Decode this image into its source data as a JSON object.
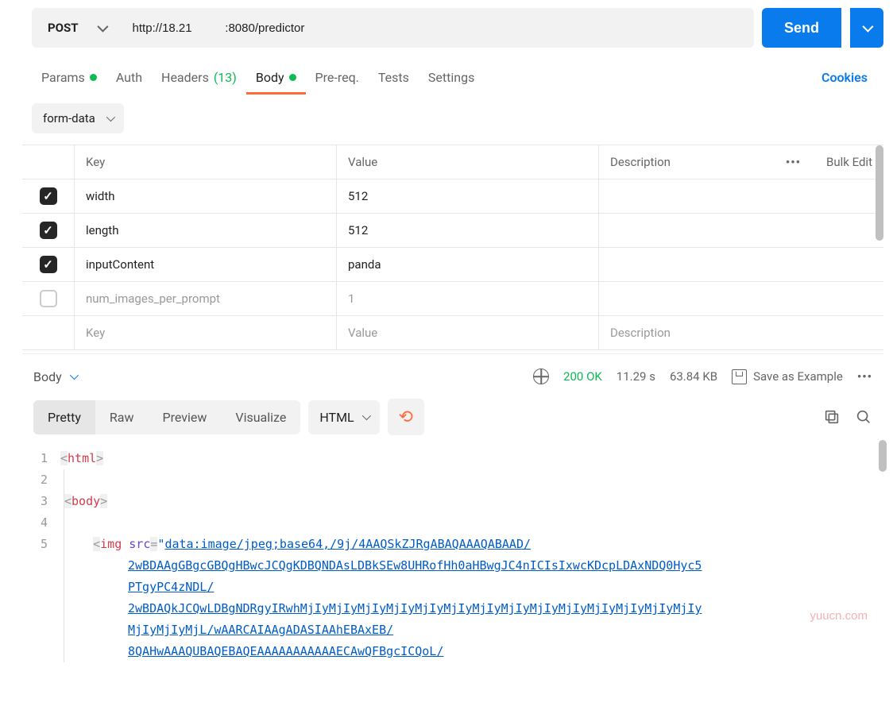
{
  "request": {
    "method": "POST",
    "url": "http://18.21          :8080/predictor",
    "send_label": "Send"
  },
  "tabs": {
    "params": "Params",
    "auth": "Auth",
    "headers": "Headers",
    "headers_count": "(13)",
    "body": "Body",
    "prereq": "Pre-req.",
    "tests": "Tests",
    "settings": "Settings",
    "cookies": "Cookies"
  },
  "body_type": "form-data",
  "table": {
    "header_key": "Key",
    "header_value": "Value",
    "header_desc": "Description",
    "bulk_edit": "Bulk Edit",
    "rows": [
      {
        "enabled": true,
        "key": "width",
        "value": "512",
        "desc": ""
      },
      {
        "enabled": true,
        "key": "length",
        "value": "512",
        "desc": ""
      },
      {
        "enabled": true,
        "key": "inputContent",
        "value": "panda",
        "desc": ""
      },
      {
        "enabled": false,
        "key": "num_images_per_prompt",
        "value": "1",
        "desc": ""
      }
    ],
    "placeholder_key": "Key",
    "placeholder_value": "Value",
    "placeholder_desc": "Description"
  },
  "response": {
    "label": "Body",
    "status_code": "200",
    "status_text": "OK",
    "time": "11.29 s",
    "size": "63.84 KB",
    "save_example": "Save as Example",
    "view_tabs": [
      "Pretty",
      "Raw",
      "Preview",
      "Visualize"
    ],
    "active_view": "Pretty",
    "format": "HTML"
  },
  "code": {
    "lines": {
      "l1_tag": "html",
      "l3_tag": "body",
      "l5_tag": "img",
      "l5_attr": "src",
      "l5_url_part1": "data:image/jpeg;base64,/9j/4AAQSkZJRgABAQAAAQABAAD/",
      "l5_url_part2": "2wBDAAgGBgcGBQgHBwcJCQgKDBQNDAsLDBkSEw8UHRofHh0aHBwgJC4nICIsIxwcKDcpLDAxNDQ0Hyc5",
      "l5_url_part3": "PTgyPC4zNDL/",
      "l5_url_part4": "2wBDAQkJCQwLDBgNDRgyIRwhMjIyMjIyMjIyMjIyMjIyMjIyMjIyMjIyMjIyMjIyMjIyMjIyMjIyMjIy",
      "l5_url_part5": "MjIyMjIyMjL/wAARCAIAAgADASIAAhEBAxEB/",
      "l5_url_part6": "8QAHwAAAQUBAQEBAQEAAAAAAAAAAAECAwQFBgcICQoL/"
    }
  },
  "watermark": "yuucn.com"
}
